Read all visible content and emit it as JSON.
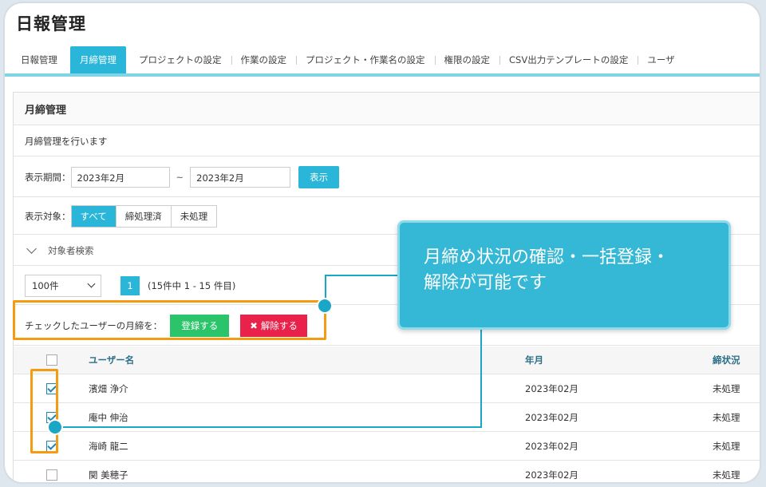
{
  "app_title": "日報管理",
  "tabs": [
    {
      "label": "日報管理",
      "active": false
    },
    {
      "label": "月締管理",
      "active": true
    },
    {
      "label": "プロジェクトの設定",
      "active": false
    },
    {
      "label": "作業の設定",
      "active": false
    },
    {
      "label": "プロジェクト・作業名の設定",
      "active": false
    },
    {
      "label": "権限の設定",
      "active": false
    },
    {
      "label": "CSV出力テンプレートの設定",
      "active": false
    },
    {
      "label": "ユーザ",
      "active": false
    }
  ],
  "panel": {
    "title": "月締管理",
    "description": "月締管理を行います",
    "period": {
      "label": "表示期間：",
      "from": "2023年2月",
      "separator": "~",
      "to": "2023年2月",
      "button": "表示"
    },
    "target": {
      "label": "表示対象：",
      "options": [
        "すべて",
        "締処理済",
        "未処理"
      ],
      "selected": "すべて"
    },
    "search": {
      "chevron": "chevron-down-icon",
      "label": "対象者検索"
    },
    "pager": {
      "per_page": "100件",
      "page": "1",
      "summary": "(15件中 1 - 15 件目)"
    },
    "bulk": {
      "label": "チェックしたユーザーの月締を：",
      "register": "登録する",
      "cancel_icon": "close-icon",
      "cancel": "解除する"
    }
  },
  "table": {
    "headers": {
      "name": "ユーザー名",
      "ym": "年月",
      "status": "締状況"
    },
    "rows": [
      {
        "checked": true,
        "name": "濱畑 浄介",
        "ym": "2023年02月",
        "status": "未処理"
      },
      {
        "checked": true,
        "name": "庵中 伸治",
        "ym": "2023年02月",
        "status": "未処理"
      },
      {
        "checked": true,
        "name": "海崎 龍二",
        "ym": "2023年02月",
        "status": "未処理"
      },
      {
        "checked": false,
        "name": "関 美穂子",
        "ym": "2023年02月",
        "status": "未処理"
      }
    ]
  },
  "callout": {
    "line1": "月締め状況の確認・一括登録・",
    "line2": "解除が可能です"
  },
  "colors": {
    "accent": "#29b6d8",
    "highlight": "#f39c12",
    "green": "#2cc46a",
    "red": "#e8224b"
  }
}
